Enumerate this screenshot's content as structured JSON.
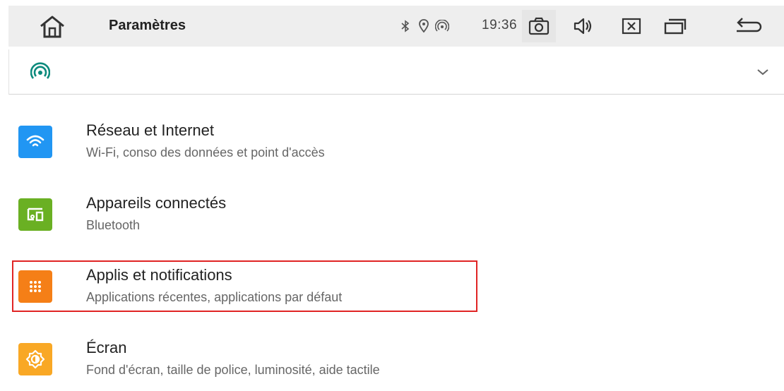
{
  "topbar": {
    "home_icon": "home-icon",
    "title": "Paramètres",
    "status_icons": [
      "bluetooth-icon",
      "location-icon",
      "hotspot-icon"
    ],
    "clock": "19:36",
    "buttons": [
      "camera-icon",
      "volume-icon",
      "close-window-icon",
      "recent-apps-icon",
      "back-icon"
    ]
  },
  "hotspot_bar": {
    "icon": "hotspot-icon",
    "expand_icon": "chevron-down-icon"
  },
  "settings": [
    {
      "title": "Réseau et Internet",
      "subtitle": "Wi-Fi, conso des données et point d'accès",
      "icon": "wifi-icon",
      "color": "#2196f3"
    },
    {
      "title": "Appareils connectés",
      "subtitle": "Bluetooth",
      "icon": "connected-devices-icon",
      "color": "#6ab023"
    },
    {
      "title": "Applis et notifications",
      "subtitle": "Applications récentes, applications par défaut",
      "icon": "apps-grid-icon",
      "color": "#f57f17"
    },
    {
      "title": "Écran",
      "subtitle": "Fond d'écran, taille de police, luminosité, aide tactile",
      "icon": "brightness-icon",
      "color": "#f9a825"
    }
  ],
  "highlight_color": "#e02424",
  "accent_teal": "#0b8a7c"
}
